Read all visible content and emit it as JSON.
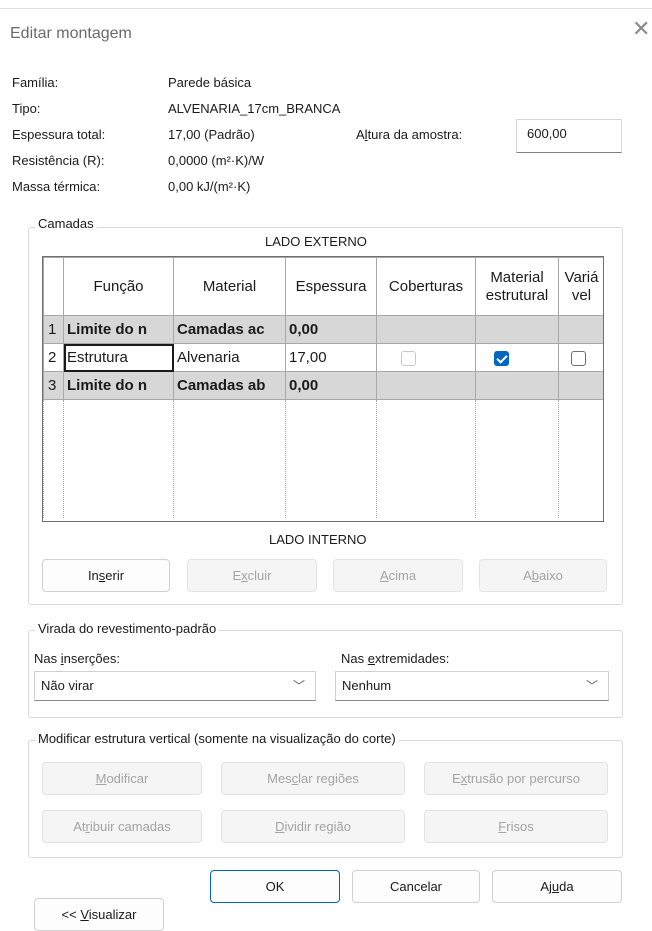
{
  "window": {
    "title": "Editar montagem",
    "close_glyph": "✕"
  },
  "properties": {
    "familia_label": "Família:",
    "familia_value": "Parede básica",
    "tipo_label": "Tipo:",
    "tipo_value": "ALVENARIA_17cm_BRANCA",
    "espessura_label": "Espessura total:",
    "espessura_value": "17,00 (Padrão)",
    "altura_label_pre": "A",
    "altura_label_u": "l",
    "altura_label_post": "tura da amostra:",
    "altura_value": "600,00",
    "resistencia_label": "Resistência (R):",
    "resistencia_value": "0,0000 (m²·K)/W",
    "massa_label": "Massa térmica:",
    "massa_value": "0,00 kJ/(m²·K)"
  },
  "layers": {
    "legend": "Camadas",
    "top_side": "LADO EXTERNO",
    "bottom_side": "LADO INTERNO",
    "columns": [
      "Função",
      "Material",
      "Espessura",
      "Coberturas",
      "Material estrutural",
      "Variá vel"
    ],
    "rows": [
      {
        "num": "1",
        "funcao": "Limite do n",
        "material": "Camadas ac",
        "espessura": "0,00"
      },
      {
        "num": "2",
        "funcao": "Estrutura",
        "material": "Alvenaria",
        "espessura": "17,00"
      },
      {
        "num": "3",
        "funcao": "Limite do n",
        "material": "Camadas ab",
        "espessura": "0,00"
      }
    ],
    "buttons": {
      "inserir_pre": "In",
      "inserir_u": "s",
      "inserir_post": "erir",
      "excluir_pre": "E",
      "excluir_u": "x",
      "excluir_post": "cluir",
      "acima_pre": "",
      "acima_u": "A",
      "acima_post": "cima",
      "abaixo_pre": "A",
      "abaixo_u": "b",
      "abaixo_post": "aixo"
    }
  },
  "wrap": {
    "legend": "Virada do revestimento-padrão",
    "insercoes_pre": "Nas ",
    "insercoes_u": "i",
    "insercoes_post": "nserções:",
    "insercoes_value": "Não virar",
    "extremidades_pre": "Nas ",
    "extremidades_u": "e",
    "extremidades_post": "xtremidades:",
    "extremidades_value": "Nenhum"
  },
  "vertical": {
    "legend": "Modificar estrutura vertical (somente na visualização do corte)",
    "modificar_pre": "",
    "modificar_u": "M",
    "modificar_post": "odificar",
    "mesclar_pre": "Mes",
    "mesclar_u": "c",
    "mesclar_post": "lar regiões",
    "extrusao_pre": "E",
    "extrusao_u": "x",
    "extrusao_post": "trusão por percurso",
    "atribuir_pre": "At",
    "atribuir_u": "r",
    "atribuir_post": "ibuir camadas",
    "dividir_pre": "",
    "dividir_u": "D",
    "dividir_post": "ividir região",
    "frisos_pre": "",
    "frisos_u": "F",
    "frisos_post": "risos"
  },
  "footer": {
    "ok": "OK",
    "cancelar": "Cancelar",
    "ajuda_pre": "Aj",
    "ajuda_u": "u",
    "ajuda_post": "da",
    "visualizar_pre": "<< ",
    "visualizar_u": "V",
    "visualizar_post": "isualizar"
  },
  "colors": {
    "accent": "#0067c0",
    "boundary_row": "#d7d7d7",
    "disabled_text": "#a3a3a3"
  }
}
